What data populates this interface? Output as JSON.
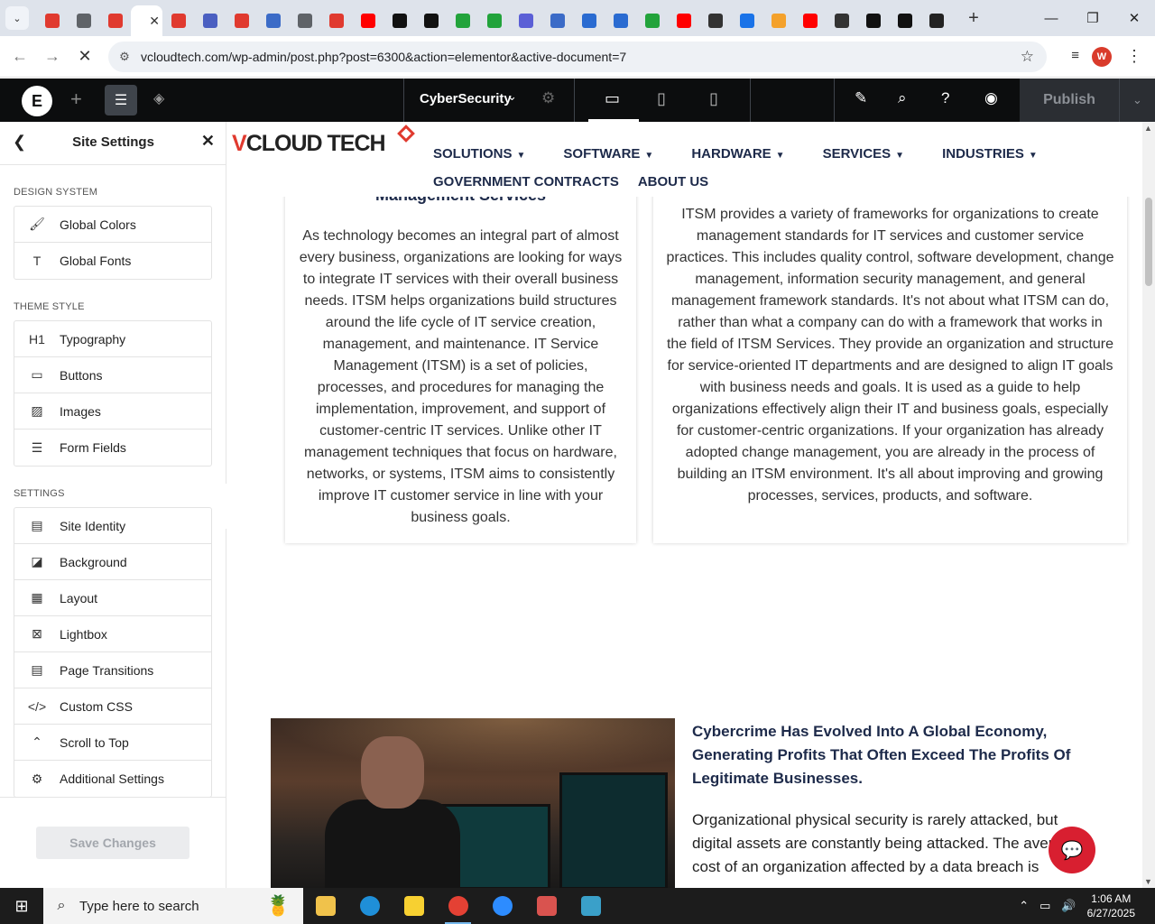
{
  "browser": {
    "tabs": [
      {
        "icon": "red-diamond-icon",
        "color": "#e03a2f"
      },
      {
        "icon": "globe-icon",
        "color": "#5f6368"
      },
      {
        "icon": "red-diamond-icon",
        "color": "#e03a2f"
      },
      {
        "icon": "red-diamond-icon",
        "color": "#e03a2f",
        "active": true
      },
      {
        "icon": "red-diamond-icon",
        "color": "#e03a2f"
      },
      {
        "icon": "blue-swirl-icon",
        "color": "#4a5fc1"
      },
      {
        "icon": "red-diamond-icon",
        "color": "#e03a2f"
      },
      {
        "icon": "chart-icon",
        "color": "#3b6bc7"
      },
      {
        "icon": "globe-icon",
        "color": "#5f6368"
      },
      {
        "icon": "red-diamond-icon",
        "color": "#e03a2f"
      },
      {
        "icon": "youtube-icon",
        "color": "#ff0000"
      },
      {
        "icon": "openai-icon",
        "color": "#111111"
      },
      {
        "icon": "openai-icon",
        "color": "#111111"
      },
      {
        "icon": "green-bolt-icon",
        "color": "#22a33b"
      },
      {
        "icon": "green-bolt-icon",
        "color": "#22a33b"
      },
      {
        "icon": "purple-gear-icon",
        "color": "#5b5fd6"
      },
      {
        "icon": "chart-icon",
        "color": "#3b6bc7"
      },
      {
        "icon": "blue-grid-icon",
        "color": "#2a6bd1"
      },
      {
        "icon": "blue-grid-icon",
        "color": "#2a6bd1"
      },
      {
        "icon": "green-bolt-icon",
        "color": "#22a33b"
      },
      {
        "icon": "youtube-icon",
        "color": "#ff0000"
      },
      {
        "icon": "lock-person-icon",
        "color": "#333333"
      },
      {
        "icon": "blue-arc-icon",
        "color": "#1a73e8"
      },
      {
        "icon": "colorful-circle-icon",
        "color": "#f4a12b"
      },
      {
        "icon": "youtube-icon",
        "color": "#ff0000"
      },
      {
        "icon": "speaker-icon",
        "color": "#333333"
      },
      {
        "icon": "x-logo-icon",
        "color": "#111111"
      },
      {
        "icon": "x-logo-icon",
        "color": "#111111"
      },
      {
        "icon": "dark-square-icon",
        "color": "#222222"
      }
    ],
    "url": "vcloudtech.com/wp-admin/post.php?post=6300&action=elementor&active-document=7",
    "profile_initial": "W"
  },
  "editor": {
    "document_name": "CyberSecurity",
    "publish_label": "Publish"
  },
  "panel": {
    "title": "Site Settings",
    "sections": [
      {
        "heading": "Design System",
        "items": [
          {
            "label": "Global Colors",
            "icon": "brush-icon",
            "glyph": "🖌"
          },
          {
            "label": "Global Fonts",
            "icon": "font-icon",
            "glyph": "T"
          }
        ]
      },
      {
        "heading": "Theme Style",
        "items": [
          {
            "label": "Typography",
            "icon": "heading-icon",
            "glyph": "H1"
          },
          {
            "label": "Buttons",
            "icon": "button-icon",
            "glyph": "▭"
          },
          {
            "label": "Images",
            "icon": "image-icon",
            "glyph": "▨"
          },
          {
            "label": "Form Fields",
            "icon": "form-icon",
            "glyph": "☰"
          }
        ]
      },
      {
        "heading": "Settings",
        "items": [
          {
            "label": "Site Identity",
            "icon": "site-identity-icon",
            "glyph": "▤"
          },
          {
            "label": "Background",
            "icon": "background-icon",
            "glyph": "◪"
          },
          {
            "label": "Layout",
            "icon": "layout-icon",
            "glyph": "▦"
          },
          {
            "label": "Lightbox",
            "icon": "lightbox-icon",
            "glyph": "⊠"
          },
          {
            "label": "Page Transitions",
            "icon": "transitions-icon",
            "glyph": "▤"
          },
          {
            "label": "Custom CSS",
            "icon": "css-icon",
            "glyph": "</>"
          },
          {
            "label": "Scroll to Top",
            "icon": "scroll-top-icon",
            "glyph": "⌃"
          },
          {
            "label": "Additional Settings",
            "icon": "additional-icon",
            "glyph": "⚙"
          }
        ]
      }
    ],
    "save_label": "Save Changes"
  },
  "site": {
    "logo_v": "V",
    "logo_rest": "CLOUD TECH",
    "menu_row1": [
      "SOLUTIONS",
      "SOFTWARE",
      "HARDWARE",
      "SERVICES",
      "INDUSTRIES"
    ],
    "menu_row2": [
      "GOVERNMENT CONTRACTS",
      "ABOUT US"
    ],
    "card1_heading": "Management Services",
    "card1_text": "As technology becomes an integral part of almost every business, organizations are looking for ways to integrate IT services with their overall business needs. ITSM helps organizations build structures around the life cycle of IT service creation, management, and maintenance. IT Service Management (ITSM) is a set of policies, processes, and procedures for managing the implementation, improvement, and support of customer-centric IT services. Unlike other IT management techniques that focus on hardware, networks, or systems, ITSM aims to consistently improve IT customer service in line with your business goals.",
    "card2_text": "ITSM provides a variety of frameworks for organizations to create management standards for IT services and customer service practices. This includes quality control, software development, change management, information security management, and general management framework standards. It's not about what ITSM can do, rather than what a company can do with a framework that works in the field of ITSM Services. They provide an organization and structure for service-oriented IT departments and are designed to align IT goals with business needs and goals. It is used as a guide to help organizations effectively align their IT and business goals, especially for customer-centric organizations. If your organization has already adopted change management, you are already in the process of building an ITSM environment. It's all about improving and growing processes, services, products, and software.",
    "article_heading": "Cybercrime Has Evolved Into A Global Economy, Generating Profits That Often Exceed The Profits Of Legitimate Businesses.",
    "article_text": "Organizational physical security is rarely attacked, but digital assets are constantly being attacked. The average cost of an organization affected by a data breach is"
  },
  "taskbar": {
    "search_placeholder": "Type here to search",
    "apps": [
      {
        "icon": "file-explorer-icon",
        "color": "#f0c24b"
      },
      {
        "icon": "edge-icon",
        "color": "#1f8fd8"
      },
      {
        "icon": "sticky-notes-icon",
        "color": "#f7d031"
      },
      {
        "icon": "chrome-icon",
        "color": "#e44134",
        "running": true
      },
      {
        "icon": "zoom-icon",
        "color": "#2d8cff"
      },
      {
        "icon": "cloud-app-icon",
        "color": "#d9534f"
      },
      {
        "icon": "blue-diamond-app-icon",
        "color": "#3aa0c9"
      }
    ],
    "time": "1:06 AM",
    "date": "6/27/2025"
  }
}
